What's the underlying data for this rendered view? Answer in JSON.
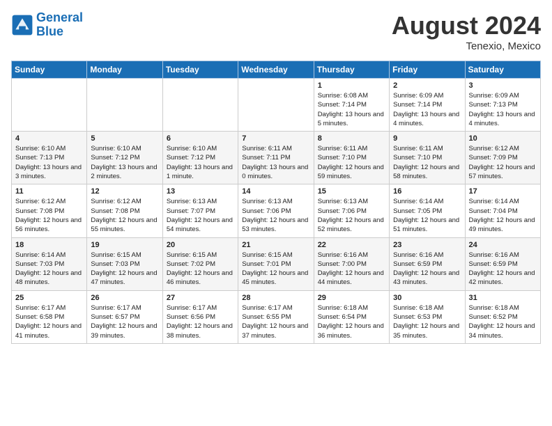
{
  "header": {
    "logo_line1": "General",
    "logo_line2": "Blue",
    "month_year": "August 2024",
    "location": "Tenexio, Mexico"
  },
  "days_of_week": [
    "Sunday",
    "Monday",
    "Tuesday",
    "Wednesday",
    "Thursday",
    "Friday",
    "Saturday"
  ],
  "weeks": [
    {
      "cells": [
        {
          "empty": true
        },
        {
          "empty": true
        },
        {
          "empty": true
        },
        {
          "empty": true
        },
        {
          "day": 1,
          "sunrise": "6:08 AM",
          "sunset": "7:14 PM",
          "daylight": "13 hours and 5 minutes."
        },
        {
          "day": 2,
          "sunrise": "6:09 AM",
          "sunset": "7:14 PM",
          "daylight": "13 hours and 4 minutes."
        },
        {
          "day": 3,
          "sunrise": "6:09 AM",
          "sunset": "7:13 PM",
          "daylight": "13 hours and 4 minutes."
        }
      ]
    },
    {
      "cells": [
        {
          "day": 4,
          "sunrise": "6:10 AM",
          "sunset": "7:13 PM",
          "daylight": "13 hours and 3 minutes."
        },
        {
          "day": 5,
          "sunrise": "6:10 AM",
          "sunset": "7:12 PM",
          "daylight": "13 hours and 2 minutes."
        },
        {
          "day": 6,
          "sunrise": "6:10 AM",
          "sunset": "7:12 PM",
          "daylight": "13 hours and 1 minute."
        },
        {
          "day": 7,
          "sunrise": "6:11 AM",
          "sunset": "7:11 PM",
          "daylight": "13 hours and 0 minutes."
        },
        {
          "day": 8,
          "sunrise": "6:11 AM",
          "sunset": "7:10 PM",
          "daylight": "12 hours and 59 minutes."
        },
        {
          "day": 9,
          "sunrise": "6:11 AM",
          "sunset": "7:10 PM",
          "daylight": "12 hours and 58 minutes."
        },
        {
          "day": 10,
          "sunrise": "6:12 AM",
          "sunset": "7:09 PM",
          "daylight": "12 hours and 57 minutes."
        }
      ]
    },
    {
      "cells": [
        {
          "day": 11,
          "sunrise": "6:12 AM",
          "sunset": "7:08 PM",
          "daylight": "12 hours and 56 minutes."
        },
        {
          "day": 12,
          "sunrise": "6:12 AM",
          "sunset": "7:08 PM",
          "daylight": "12 hours and 55 minutes."
        },
        {
          "day": 13,
          "sunrise": "6:13 AM",
          "sunset": "7:07 PM",
          "daylight": "12 hours and 54 minutes."
        },
        {
          "day": 14,
          "sunrise": "6:13 AM",
          "sunset": "7:06 PM",
          "daylight": "12 hours and 53 minutes."
        },
        {
          "day": 15,
          "sunrise": "6:13 AM",
          "sunset": "7:06 PM",
          "daylight": "12 hours and 52 minutes."
        },
        {
          "day": 16,
          "sunrise": "6:14 AM",
          "sunset": "7:05 PM",
          "daylight": "12 hours and 51 minutes."
        },
        {
          "day": 17,
          "sunrise": "6:14 AM",
          "sunset": "7:04 PM",
          "daylight": "12 hours and 49 minutes."
        }
      ]
    },
    {
      "cells": [
        {
          "day": 18,
          "sunrise": "6:14 AM",
          "sunset": "7:03 PM",
          "daylight": "12 hours and 48 minutes."
        },
        {
          "day": 19,
          "sunrise": "6:15 AM",
          "sunset": "7:03 PM",
          "daylight": "12 hours and 47 minutes."
        },
        {
          "day": 20,
          "sunrise": "6:15 AM",
          "sunset": "7:02 PM",
          "daylight": "12 hours and 46 minutes."
        },
        {
          "day": 21,
          "sunrise": "6:15 AM",
          "sunset": "7:01 PM",
          "daylight": "12 hours and 45 minutes."
        },
        {
          "day": 22,
          "sunrise": "6:16 AM",
          "sunset": "7:00 PM",
          "daylight": "12 hours and 44 minutes."
        },
        {
          "day": 23,
          "sunrise": "6:16 AM",
          "sunset": "6:59 PM",
          "daylight": "12 hours and 43 minutes."
        },
        {
          "day": 24,
          "sunrise": "6:16 AM",
          "sunset": "6:59 PM",
          "daylight": "12 hours and 42 minutes."
        }
      ]
    },
    {
      "cells": [
        {
          "day": 25,
          "sunrise": "6:17 AM",
          "sunset": "6:58 PM",
          "daylight": "12 hours and 41 minutes."
        },
        {
          "day": 26,
          "sunrise": "6:17 AM",
          "sunset": "6:57 PM",
          "daylight": "12 hours and 39 minutes."
        },
        {
          "day": 27,
          "sunrise": "6:17 AM",
          "sunset": "6:56 PM",
          "daylight": "12 hours and 38 minutes."
        },
        {
          "day": 28,
          "sunrise": "6:17 AM",
          "sunset": "6:55 PM",
          "daylight": "12 hours and 37 minutes."
        },
        {
          "day": 29,
          "sunrise": "6:18 AM",
          "sunset": "6:54 PM",
          "daylight": "12 hours and 36 minutes."
        },
        {
          "day": 30,
          "sunrise": "6:18 AM",
          "sunset": "6:53 PM",
          "daylight": "12 hours and 35 minutes."
        },
        {
          "day": 31,
          "sunrise": "6:18 AM",
          "sunset": "6:52 PM",
          "daylight": "12 hours and 34 minutes."
        }
      ]
    }
  ]
}
